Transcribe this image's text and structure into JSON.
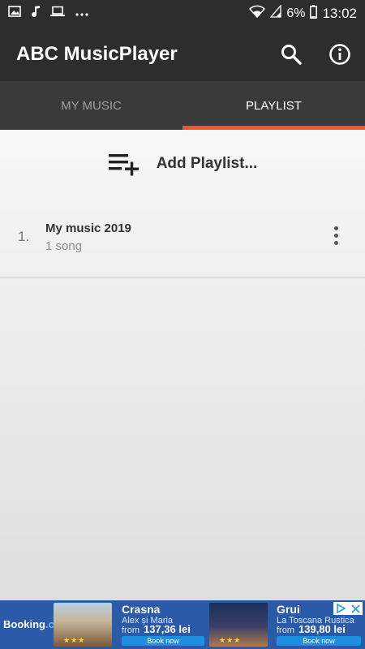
{
  "status_bar": {
    "battery_percent": "6%",
    "time": "13:02",
    "left_icons": [
      "image-icon",
      "music-note-icon",
      "laptop-icon",
      "more-dots-icon"
    ],
    "right_icons": [
      "wifi-icon",
      "signal-icon",
      "battery-icon"
    ]
  },
  "app_bar": {
    "title": "ABC MusicPlayer",
    "actions": [
      "search-icon",
      "info-icon"
    ]
  },
  "tabs": [
    {
      "label": "MY MUSIC",
      "active": false
    },
    {
      "label": "PLAYLIST",
      "active": true
    }
  ],
  "add_playlist": {
    "label": "Add Playlist...",
    "icon": "playlist-add-icon"
  },
  "playlists": [
    {
      "index": "1.",
      "title": "My music 2019",
      "subtitle": "1 song"
    }
  ],
  "ad": {
    "logo_prefix": "Booking",
    "logo_suffix": ".com",
    "hotels": [
      {
        "name": "Crasna",
        "subtitle": "Alex și Maria",
        "from": "from",
        "price": "137,36 lei",
        "button": "Book now",
        "stars": "★★★"
      },
      {
        "name": "Grui",
        "subtitle": "La Toscana Rustica",
        "from": "from",
        "price": "139,80 lei",
        "button": "Book now",
        "stars": "★★★"
      }
    ]
  },
  "colors": {
    "app_bar": "#2d2d2d",
    "tab_bar": "#3a3a3a",
    "accent": "#f0552a",
    "ad_background": "#2b5aa8"
  }
}
